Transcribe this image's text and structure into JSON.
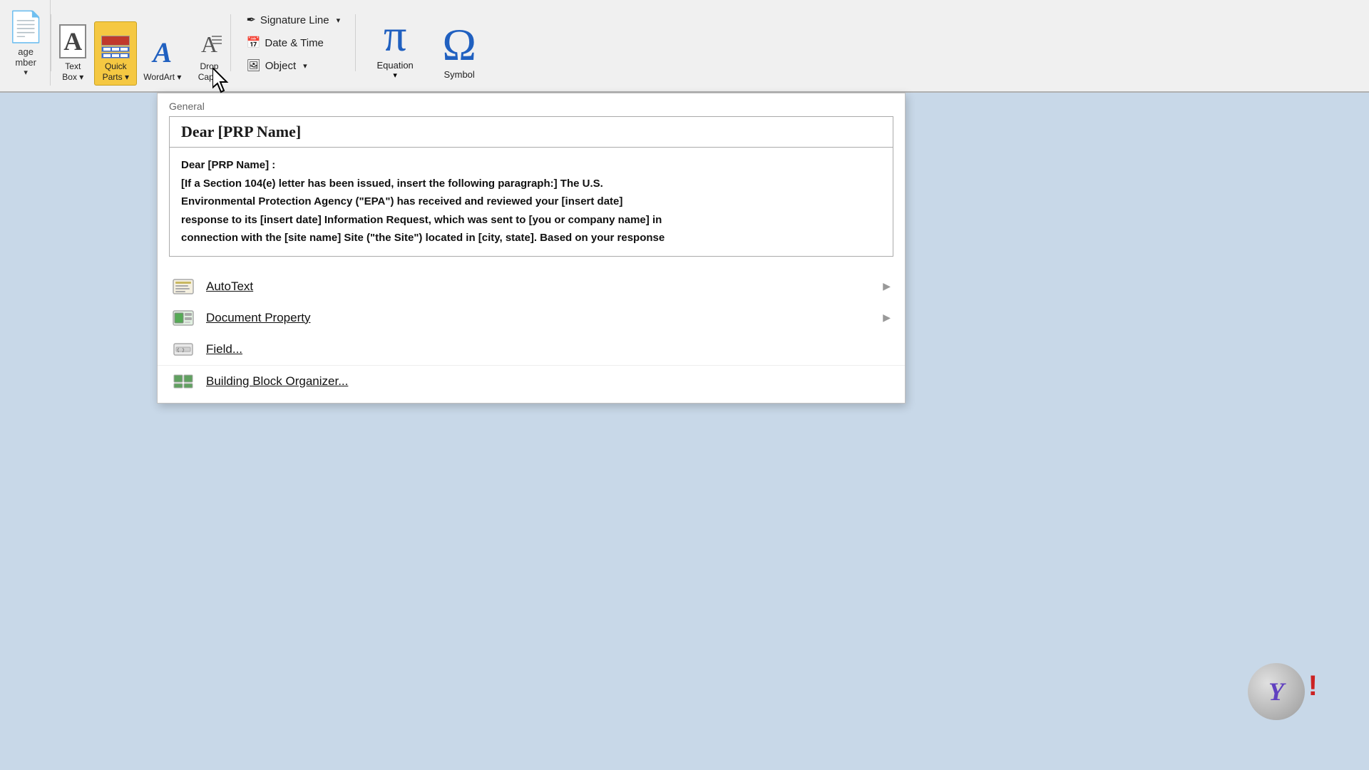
{
  "ribbon": {
    "left_partial": {
      "label1": "age",
      "label2": "mber"
    },
    "text_box_button": {
      "label": "Text\nBox",
      "label1": "Text",
      "label2": "Box"
    },
    "quick_parts_button": {
      "label": "Quick\nParts",
      "label1": "Quick",
      "label2": "Parts"
    },
    "wordart_button": {
      "label": "WordArt"
    },
    "drop_cap_button": {
      "label1": "Drop",
      "label2": "Cap"
    },
    "signature_line": {
      "label": "Signature Line"
    },
    "date_time": {
      "label": "Date & Time"
    },
    "object": {
      "label": "Object"
    },
    "equation": {
      "label": "Equation"
    },
    "symbol": {
      "label": "Symbol"
    }
  },
  "dropdown": {
    "section_label": "General",
    "entry": {
      "title": "Dear [PRP Name]",
      "preview_line1": "Dear [PRP Name] :",
      "preview_line2": "  [If a Section 104(e) letter has been issued, insert the following paragraph:]  The U.S.",
      "preview_line3": "Environmental Protection Agency (\"EPA\") has received and reviewed your [insert date]",
      "preview_line4": "response to its [insert date] Information Request, which was sent to [you or company name] in",
      "preview_line5": "connection with the [site name] Site (\"the Site\") located in [city, state].  Based on your response"
    },
    "menu_items": [
      {
        "id": "autotext",
        "label": "AutoText",
        "has_submenu": true
      },
      {
        "id": "document-property",
        "label": "Document Property",
        "has_submenu": true
      },
      {
        "id": "field",
        "label": "Field...",
        "has_submenu": false
      },
      {
        "id": "building-block-organizer",
        "label": "Building Block Organizer...",
        "has_submenu": false
      }
    ]
  },
  "assistant": {
    "letter": "Y",
    "exclaim": "!"
  }
}
